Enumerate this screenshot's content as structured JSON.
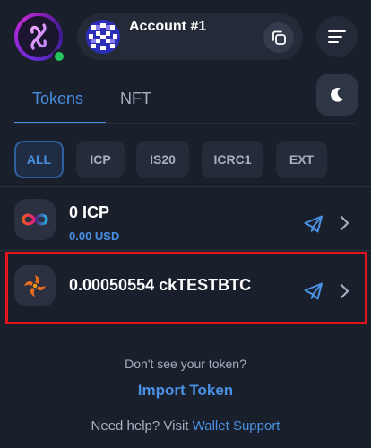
{
  "header": {
    "account_name": "Account #1",
    "online_color": "#22c55e",
    "icons": {
      "logo": "plug-logo-icon",
      "copy": "copy-icon",
      "menu": "menu-icon",
      "theme": "moon-icon"
    }
  },
  "tabs": [
    {
      "label": "Tokens",
      "active": true
    },
    {
      "label": "NFT",
      "active": false
    }
  ],
  "filters": [
    {
      "label": "ALL",
      "active": true
    },
    {
      "label": "ICP",
      "active": false
    },
    {
      "label": "IS20",
      "active": false
    },
    {
      "label": "ICRC1",
      "active": false
    },
    {
      "label": "EXT",
      "active": false
    }
  ],
  "tokens": [
    {
      "amount": "0 ICP",
      "usd": "0.00 USD",
      "icon": "icp-infinity-icon"
    },
    {
      "amount": "0.00050554 ckTESTBTC",
      "usd": "",
      "icon": "cktestbtc-icon",
      "highlighted": true
    }
  ],
  "footer": {
    "question": "Don't see your token?",
    "import_label": "Import Token",
    "help_prefix": "Need help? Visit",
    "help_link": "Wallet Support"
  },
  "colors": {
    "background": "#1a1f2c",
    "accent": "#4a90e2",
    "highlight": "#e0151d",
    "muted_text": "#a7b0c0"
  }
}
